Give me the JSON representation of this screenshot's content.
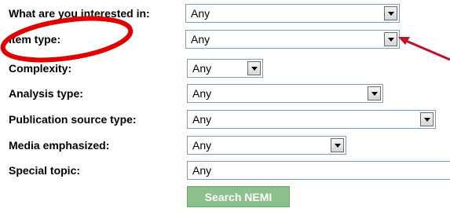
{
  "form": {
    "interest": {
      "label": "What are you interested in:",
      "value": "Any"
    },
    "item_type": {
      "label": "Item type:",
      "value": "Any"
    },
    "complexity": {
      "label": "Complexity:",
      "value": "Any"
    },
    "analysis_type": {
      "label": "Analysis type:",
      "value": "Any"
    },
    "publication_source_type": {
      "label": "Publication source type:",
      "value": "Any"
    },
    "media_emphasized": {
      "label": "Media emphasized:",
      "value": "Any"
    },
    "special_topic": {
      "label": "Special topic:",
      "value": "Any"
    }
  },
  "search_button": {
    "label": "Search NEMI"
  },
  "annotation": {
    "circle_color": "#e00000",
    "arrow_color": "#c0102a"
  },
  "colors": {
    "button_bg": "#8cc08c",
    "select_border": "#7f9db9"
  }
}
